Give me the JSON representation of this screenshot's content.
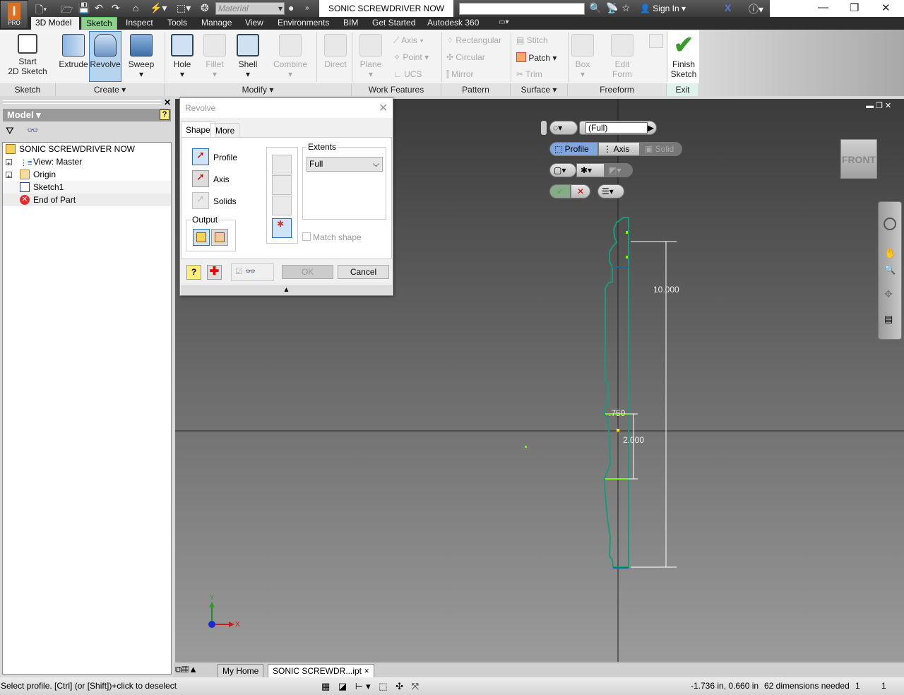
{
  "app": {
    "badge": "PRO",
    "document_title": "SONIC SCREWDRIVER NOW",
    "material_placeholder": "Material",
    "sign_in": "Sign In"
  },
  "tabs": [
    {
      "label": "3D Model"
    },
    {
      "label": "Sketch"
    },
    {
      "label": "Inspect"
    },
    {
      "label": "Tools"
    },
    {
      "label": "Manage"
    },
    {
      "label": "View"
    },
    {
      "label": "Environments"
    },
    {
      "label": "BIM"
    },
    {
      "label": "Get Started"
    },
    {
      "label": "Autodesk 360"
    }
  ],
  "ribbon": {
    "start_sketch": "Start\n2D Sketch",
    "extrude": "Extrude",
    "revolve": "Revolve",
    "sweep": "Sweep",
    "hole": "Hole",
    "fillet": "Fillet",
    "shell": "Shell",
    "combine": "Combine",
    "direct": "Direct",
    "plane": "Plane",
    "axis": "Axis",
    "point": "Point",
    "ucs": "UCS",
    "rectangular": "Rectangular",
    "circular": "Circular",
    "mirror": "Mirror",
    "stitch": "Stitch",
    "patch": "Patch",
    "trim": "Trim",
    "box": "Box",
    "edit_form": "Edit\nForm",
    "finish_sketch": "Finish\nSketch",
    "panels": [
      "Sketch",
      "Create ▾",
      "Modify ▾",
      "Work Features",
      "Pattern",
      "Surface ▾",
      "Freeform",
      "Exit"
    ]
  },
  "browser": {
    "header": "Model ▾",
    "tree": [
      {
        "label": "SONIC SCREWDRIVER NOW"
      },
      {
        "label": "View: Master"
      },
      {
        "label": "Origin"
      },
      {
        "label": "Sketch1"
      },
      {
        "label": "End of Part"
      }
    ]
  },
  "dialog": {
    "title": "Revolve",
    "tab_shape": "Shape",
    "tab_more": "More",
    "profile": "Profile",
    "axis": "Axis",
    "solids": "Solids",
    "output": "Output",
    "extents": "Extents",
    "extents_value": "Full",
    "match_shape": "Match shape",
    "ok": "OK",
    "cancel": "Cancel"
  },
  "minitoolbar": {
    "extent_value": "(Full)",
    "profile": "Profile",
    "axis": "Axis",
    "solid": "Solid"
  },
  "viewcube": "FRONT",
  "sketch": {
    "dim_length": "10.000",
    "dim_width": ".750",
    "dim_height": "2.000"
  },
  "triad": {
    "x": "X",
    "y": "Y"
  },
  "doc_tabs": [
    {
      "label": "My Home"
    },
    {
      "label": "SONIC SCREWDR...ipt"
    }
  ],
  "status": {
    "prompt": "Select profile. [Ctrl] (or [Shift])+click to deselect",
    "coords": "-1.736 in, 0.660 in",
    "dims_needed": "62 dimensions needed",
    "count1": "1",
    "count2": "1"
  }
}
